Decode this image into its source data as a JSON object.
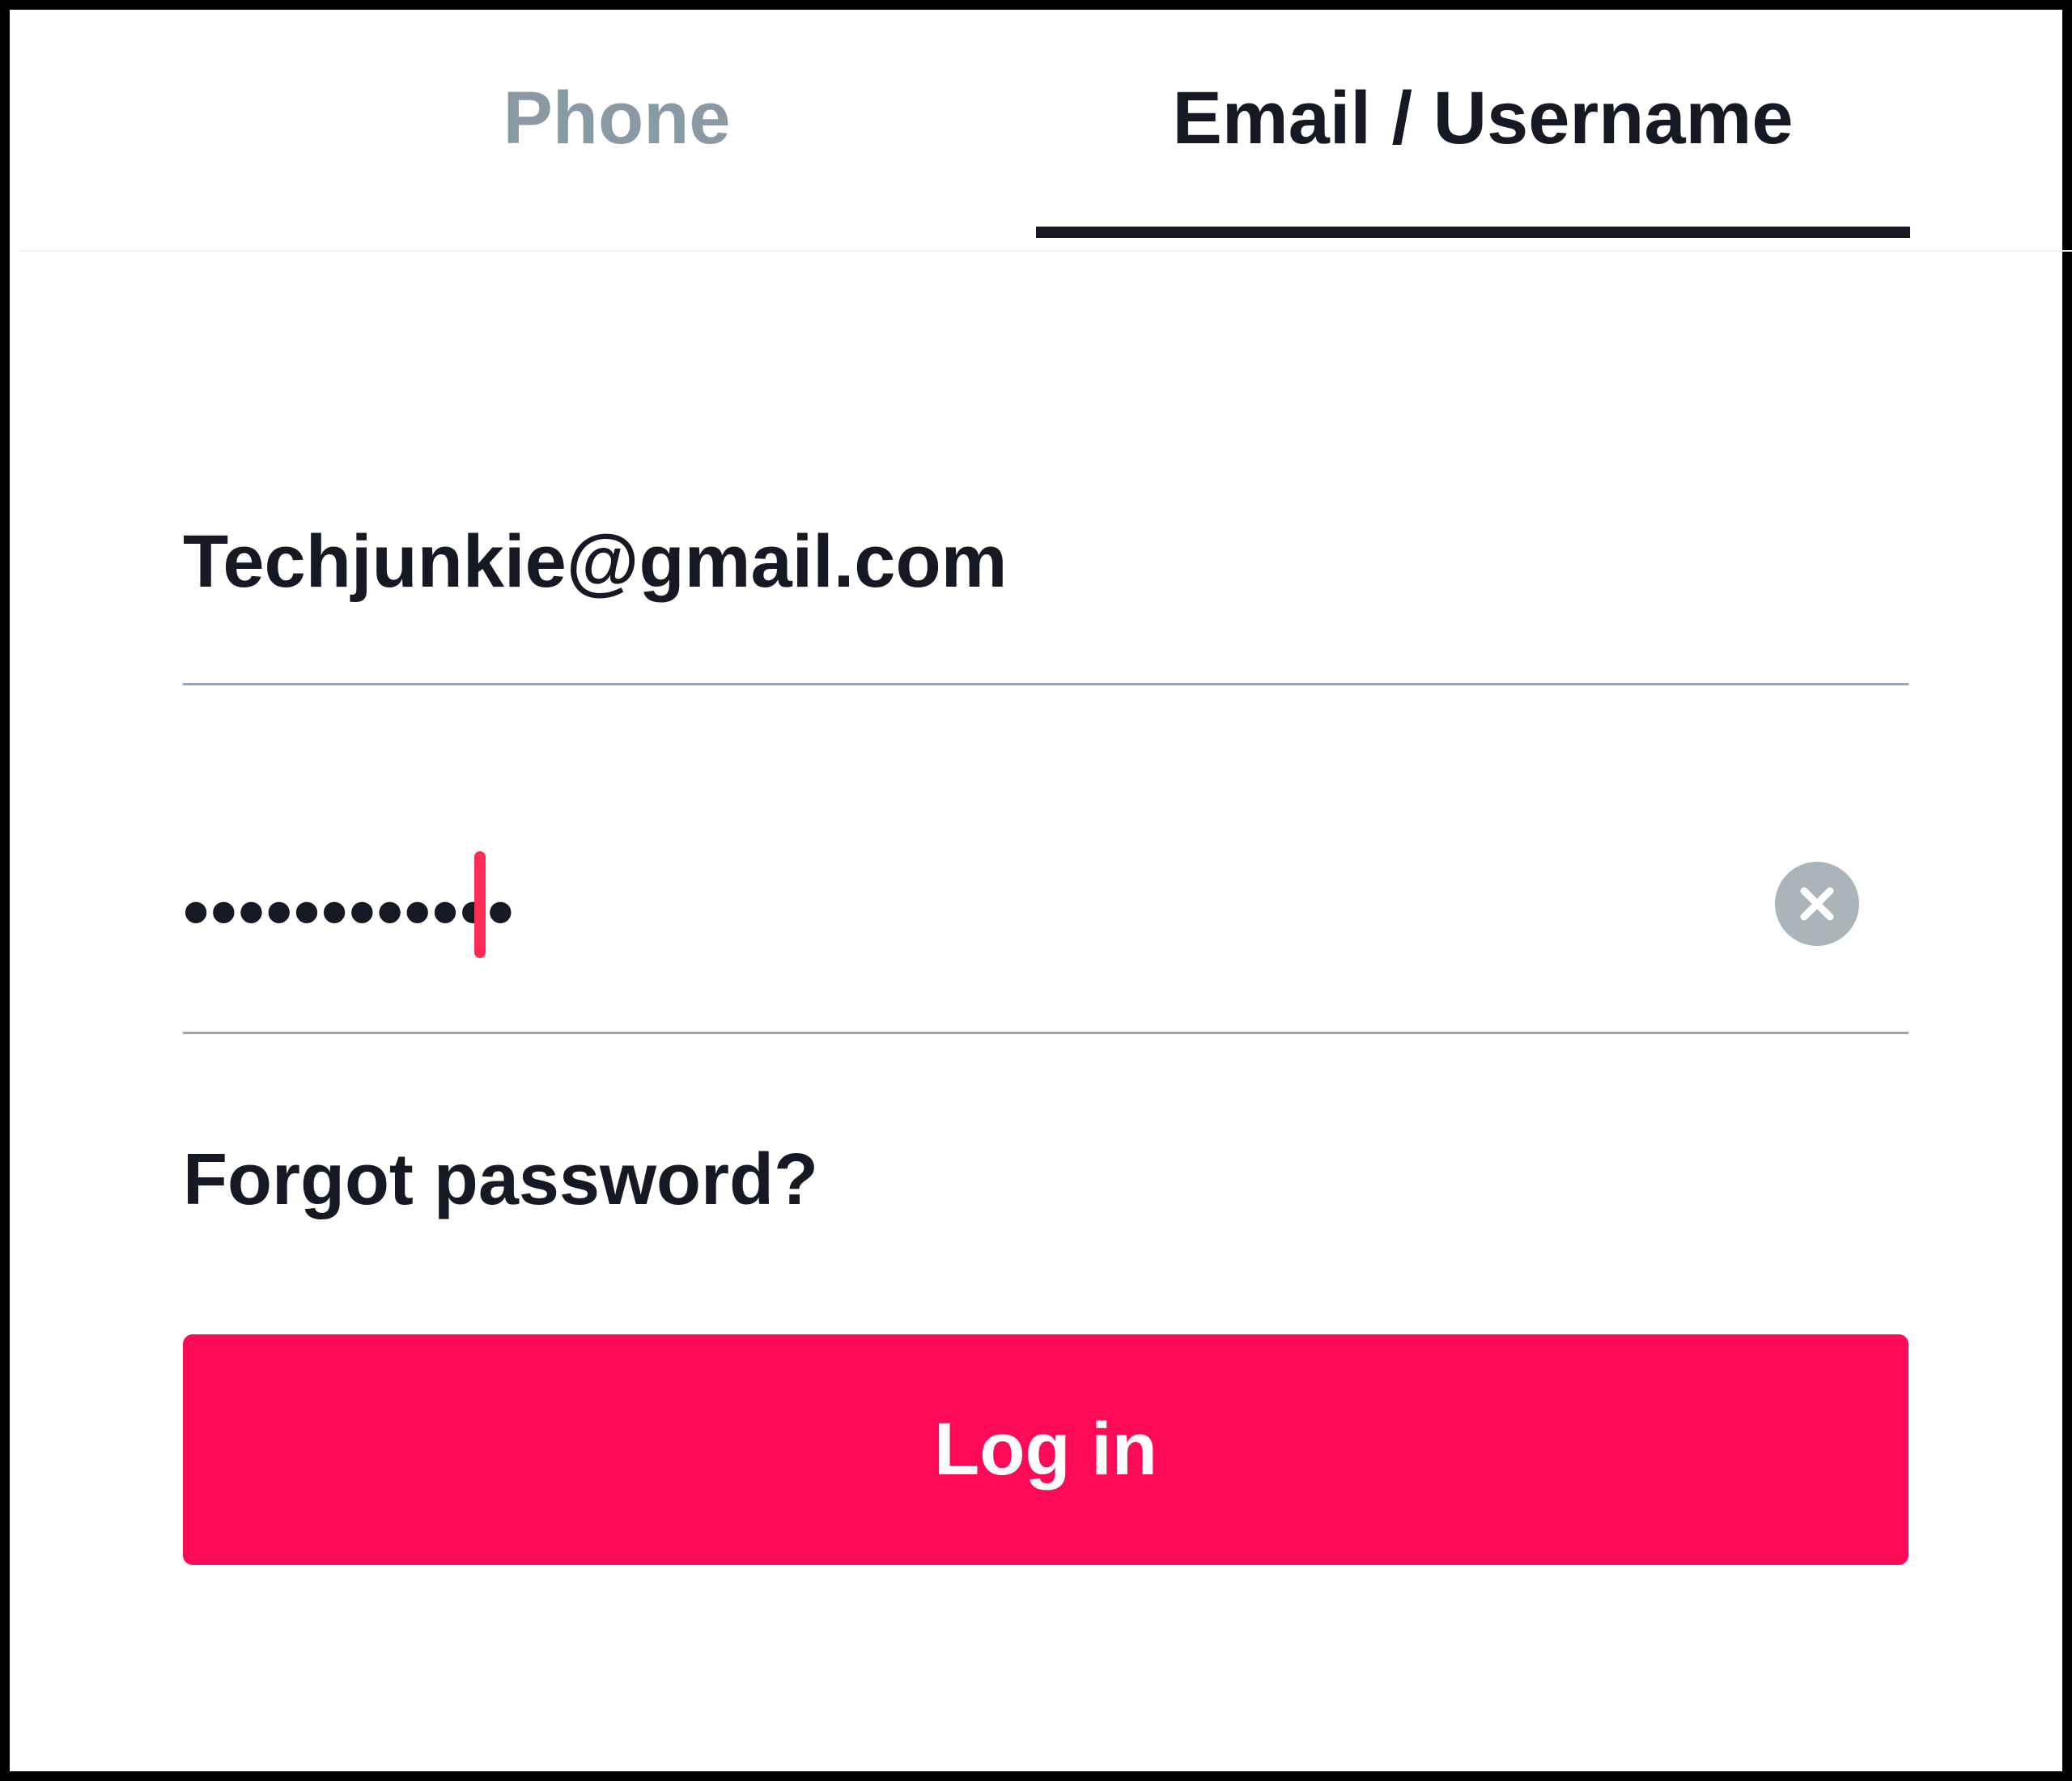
{
  "tabs": [
    {
      "label": "Phone",
      "active": false
    },
    {
      "label": "Email / Username",
      "active": true
    }
  ],
  "email_field": {
    "value": "Techjunkie@gmail.com"
  },
  "password_field": {
    "masked_value": "••••••••••••"
  },
  "forgot_password": {
    "label": "Forgot password?"
  },
  "login_button": {
    "label": "Log in"
  },
  "icons": {
    "clear": "close-circle-icon"
  },
  "colors": {
    "accent": "#fe0a56",
    "caret": "#fe2c55",
    "text_primary": "#161823",
    "text_inactive": "#8a9aa4",
    "divider": "#9aa6ad",
    "clear_icon_bg": "#aab4b9",
    "frame_border": "#000000"
  }
}
